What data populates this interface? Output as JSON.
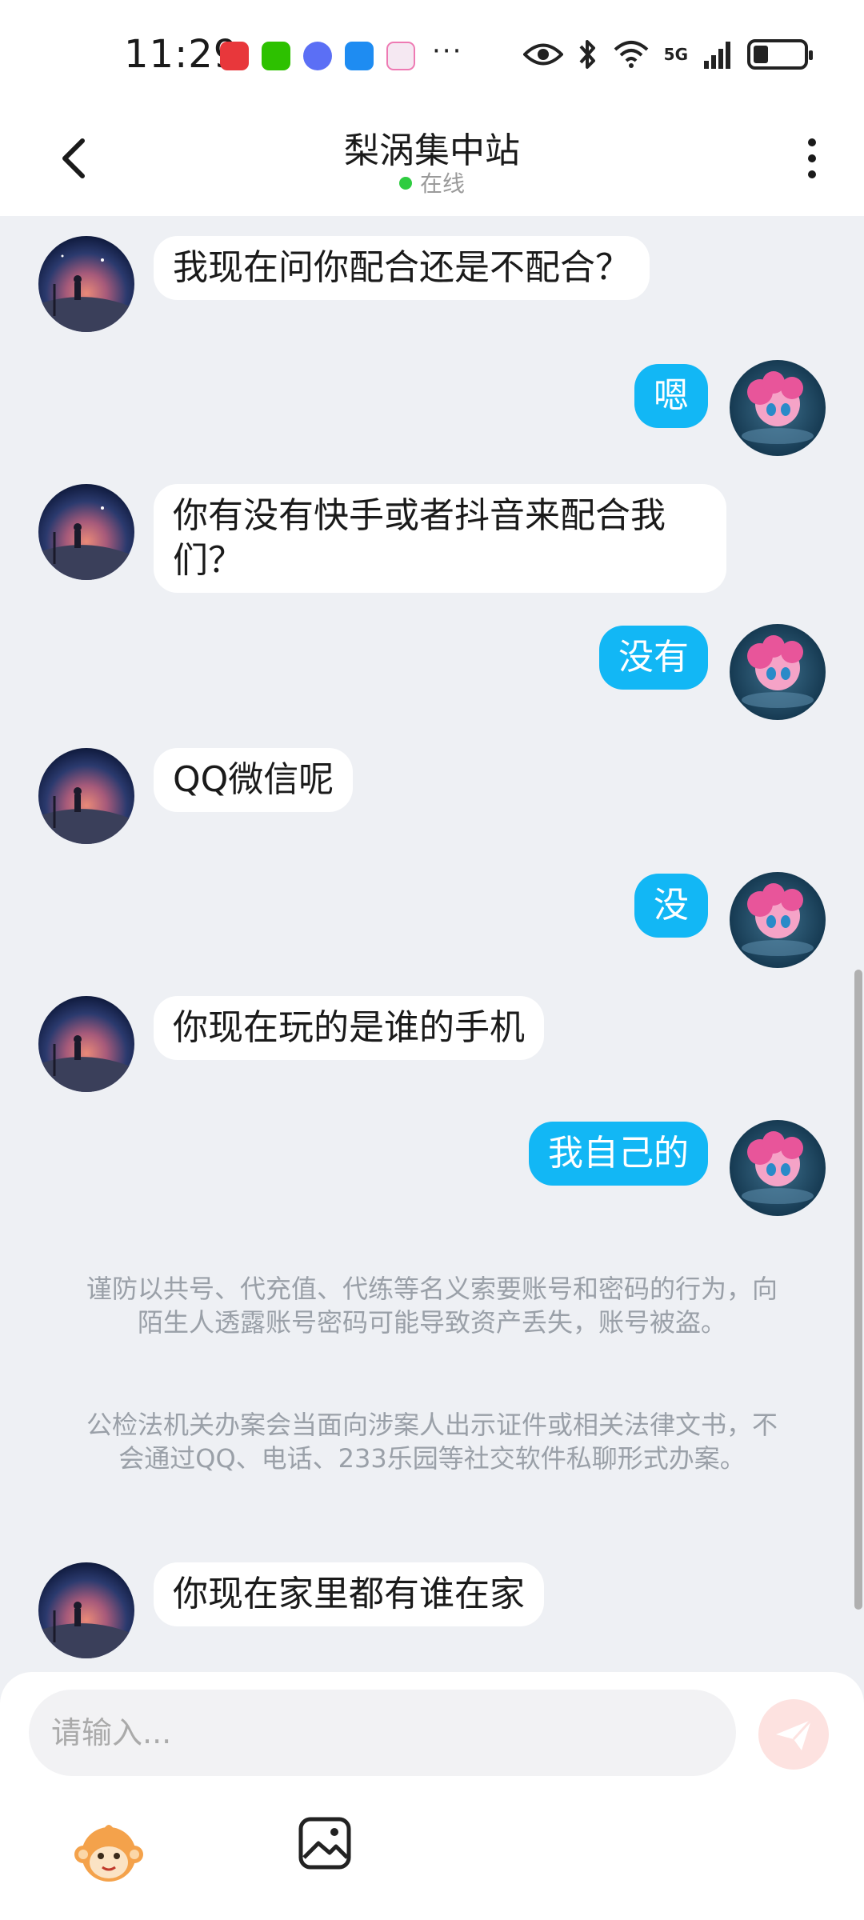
{
  "status_bar": {
    "time": "11:29",
    "more": "···",
    "network": "5G"
  },
  "header": {
    "title": "梨涡集中站",
    "status": "在线"
  },
  "messages": [
    {
      "side": "in",
      "text": "我现在问你配合还是不配合？"
    },
    {
      "side": "out",
      "text": "嗯"
    },
    {
      "side": "in",
      "text": "你有没有快手或者抖音来配合我们？"
    },
    {
      "side": "out",
      "text": "没有"
    },
    {
      "side": "in",
      "text": "QQ微信呢"
    },
    {
      "side": "out",
      "text": "没"
    },
    {
      "side": "in",
      "text": "你现在玩的是谁的手机"
    },
    {
      "side": "out",
      "text": "我自己的"
    },
    {
      "side": "in",
      "text": "你现在家里都有谁在家"
    }
  ],
  "notices": [
    "谨防以共号、代充值、代练等名义索要账号和密码的行为，向陌生人透露账号密码可能导致资产丢失，账号被盗。",
    "公检法机关办案会当面向涉案人出示证件或相关法律文书，不会通过QQ、电话、233乐园等社交软件私聊形式办案。"
  ],
  "input": {
    "placeholder": "请输入..."
  },
  "colors": {
    "outgoing_bubble": "#12b7f5",
    "incoming_bubble": "#ffffff",
    "online_dot": "#2ecc40",
    "chat_background": "#eef0f4"
  }
}
